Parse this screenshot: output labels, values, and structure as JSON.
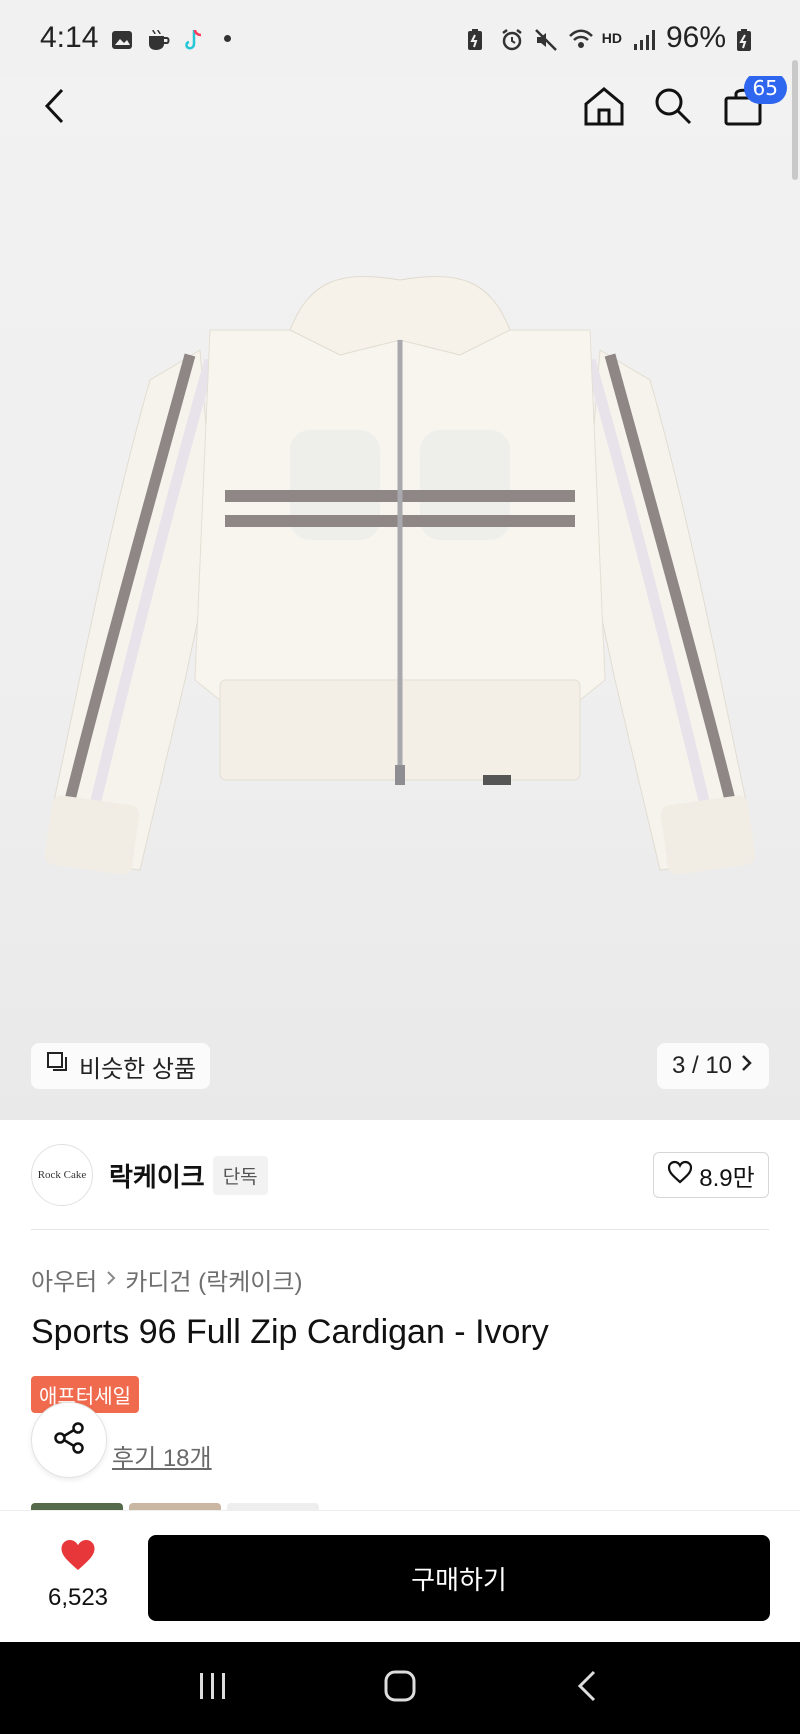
{
  "status_bar": {
    "time": "4:14",
    "battery": "96%",
    "network": "HD"
  },
  "header": {
    "cart_count": "65"
  },
  "gallery": {
    "similar_label": "비슷한 상품",
    "pager": "3 / 10"
  },
  "brand": {
    "logo_text": "Rock Cake",
    "name": "락케이크",
    "badge": "단독",
    "likes": "8.9만"
  },
  "breadcrumb": {
    "category": "아우터",
    "subcategory": "카디건 (락케이크)"
  },
  "product": {
    "title": "Sports 96 Full Zip Cardigan - Ivory",
    "sale_badge": "애프터세일",
    "review_link": "후기 18개"
  },
  "buy_bar": {
    "heart_count": "6,523",
    "buy_label": "구매하기"
  },
  "colors": {
    "heart": "#e8373a",
    "badge": "#2f66f0",
    "sale": "#f06b4e"
  }
}
